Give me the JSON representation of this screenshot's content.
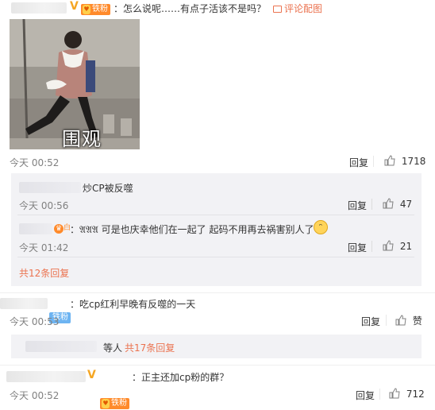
{
  "comments": [
    {
      "text": "：怎么说呢……有点子活该不是吗？",
      "image_link": "评论配图",
      "image_caption": "围观",
      "time": "今天 00:52",
      "reply_label": "回复",
      "likes": "1718"
    },
    {
      "badge": "铁粉",
      "text": "：吃cp红利早晚有反噬的一天",
      "time": "今天 00:53",
      "reply_label": "回复",
      "like_label": "赞"
    },
    {
      "badge": "铁粉",
      "text": "：正主还加cp粉的群？",
      "time": "今天 00:52",
      "reply_label": "回复",
      "likes": "712"
    }
  ],
  "replies": [
    {
      "text": "炒CP被反噬",
      "time": "今天 00:56",
      "reply_label": "回复",
      "likes": "47"
    },
    {
      "text": "：𝔄𝔄𝔄 可是也庆幸他们在一起了 起码不用再去祸害别人了",
      "time": "今天 01:42",
      "reply_label": "回复",
      "likes": "21"
    }
  ],
  "reply_summary": "共12条回复",
  "more_replies": {
    "prefix": "等人",
    "link": "共17条回复"
  },
  "colors": {
    "accent": "#eb7350",
    "badge_orange": "#ff8a2b",
    "badge_blue": "#6db4f2",
    "reply_bg": "#f2f2f5"
  }
}
